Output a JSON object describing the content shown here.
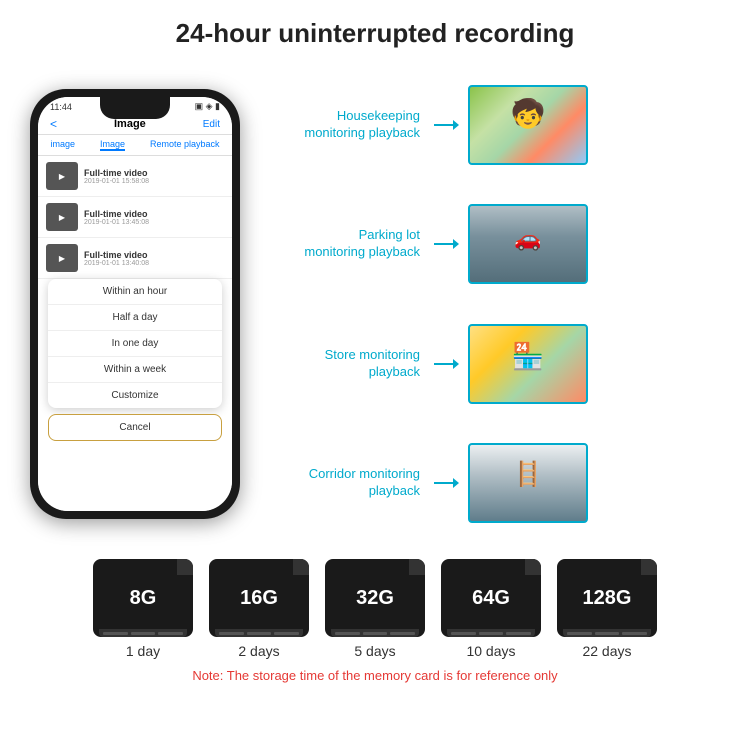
{
  "header": {
    "title": "24-hour uninterrupted recording"
  },
  "phone": {
    "time": "11:44",
    "nav_back": "<",
    "nav_title": "Image",
    "nav_edit": "Edit",
    "tabs": [
      "image",
      "Image",
      "Remote playback"
    ],
    "videos": [
      {
        "title": "Full-time video",
        "date": "2019-01-01 15:58:08"
      },
      {
        "title": "Full-time video",
        "date": "2019-01-01 13:45:08"
      },
      {
        "title": "Full-time video",
        "date": "2019-01-01 13:40:08"
      }
    ],
    "dropdown_items": [
      "Within an hour",
      "Half a day",
      "In one day",
      "Within a week",
      "Customize"
    ],
    "cancel_label": "Cancel"
  },
  "monitoring": [
    {
      "label": "Housekeeping\nmonitoring playback",
      "img_class": "img-housekeeping"
    },
    {
      "label": "Parking lot\nmonitoring playback",
      "img_class": "img-parking"
    },
    {
      "label": "Store monitoring\nplayback",
      "img_class": "img-store"
    },
    {
      "label": "Corridor monitoring\nplayback",
      "img_class": "img-corridor"
    }
  ],
  "sd_cards": [
    {
      "size": "8G",
      "days": "1 day"
    },
    {
      "size": "16G",
      "days": "2 days"
    },
    {
      "size": "32G",
      "days": "5 days"
    },
    {
      "size": "64G",
      "days": "10 days"
    },
    {
      "size": "128G",
      "days": "22 days"
    }
  ],
  "note": "Note: The storage time of the memory card is for reference only"
}
